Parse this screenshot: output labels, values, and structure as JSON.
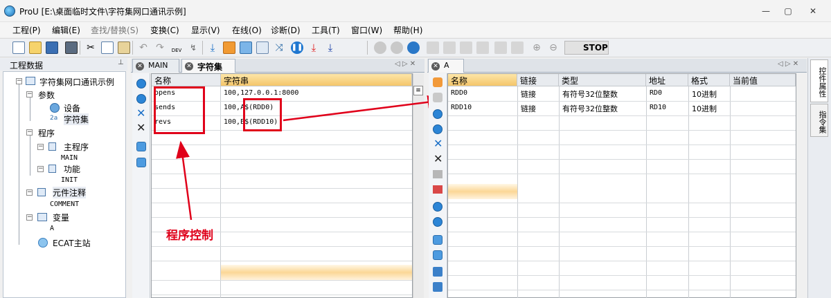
{
  "window": {
    "title": "ProU [E:\\桌面临时文件\\字符集网口通讯示例]",
    "min": "—",
    "max": "▢",
    "close": "✕"
  },
  "menu": [
    "工程(P)",
    "编辑(E)",
    "查找/替换(S)",
    "变换(C)",
    "显示(V)",
    "在线(O)",
    "诊断(D)",
    "工具(T)",
    "窗口(W)",
    "帮助(H)"
  ],
  "toolbar": {
    "stop_label": "STOP",
    "dev_label": "DEV"
  },
  "left_panel": {
    "header": "工程数据",
    "pin": "⊥",
    "tree": {
      "root": "字符集网口通讯示例",
      "params": "参数",
      "device": "设备",
      "charset": "字符集",
      "program": "程序",
      "main_program": "主程序",
      "main": "MAIN",
      "function": "功能",
      "init": "INIT",
      "element_comment": "元件注释",
      "comment": "COMMENT",
      "variables": "变量",
      "var_a": "A",
      "ecat": "ECAT主站"
    }
  },
  "middle": {
    "tabs": [
      {
        "label": "MAIN"
      },
      {
        "label": "字符集"
      }
    ],
    "nav": "◁ ▷ ✕",
    "headers": [
      "名称",
      "字符串"
    ],
    "rows": [
      {
        "name": "opens",
        "value": "100,127.0.0.1:8000"
      },
      {
        "name": "sends",
        "value": "100,A$(RDD0)"
      },
      {
        "name": "revs",
        "value": "100,B$(RDD10)"
      }
    ]
  },
  "right": {
    "tab": "A",
    "nav": "◁ ▷ ✕",
    "headers": [
      "名称",
      "链接",
      "类型",
      "地址",
      "格式",
      "当前值"
    ],
    "rows": [
      {
        "name": "RDD0",
        "link": "链接",
        "type": "有符号32位整数",
        "addr": "RD0",
        "format": "10进制",
        "value": ""
      },
      {
        "name": "RDD10",
        "link": "链接",
        "type": "有符号32位整数",
        "addr": "RD10",
        "format": "10进制",
        "value": ""
      }
    ]
  },
  "sidebar": {
    "tab1": "控件属性",
    "tab2": "指令集"
  },
  "annotation": "程序控制",
  "colors": {
    "annotation_red": "#e0001a",
    "highlight": "#f4c56a"
  }
}
